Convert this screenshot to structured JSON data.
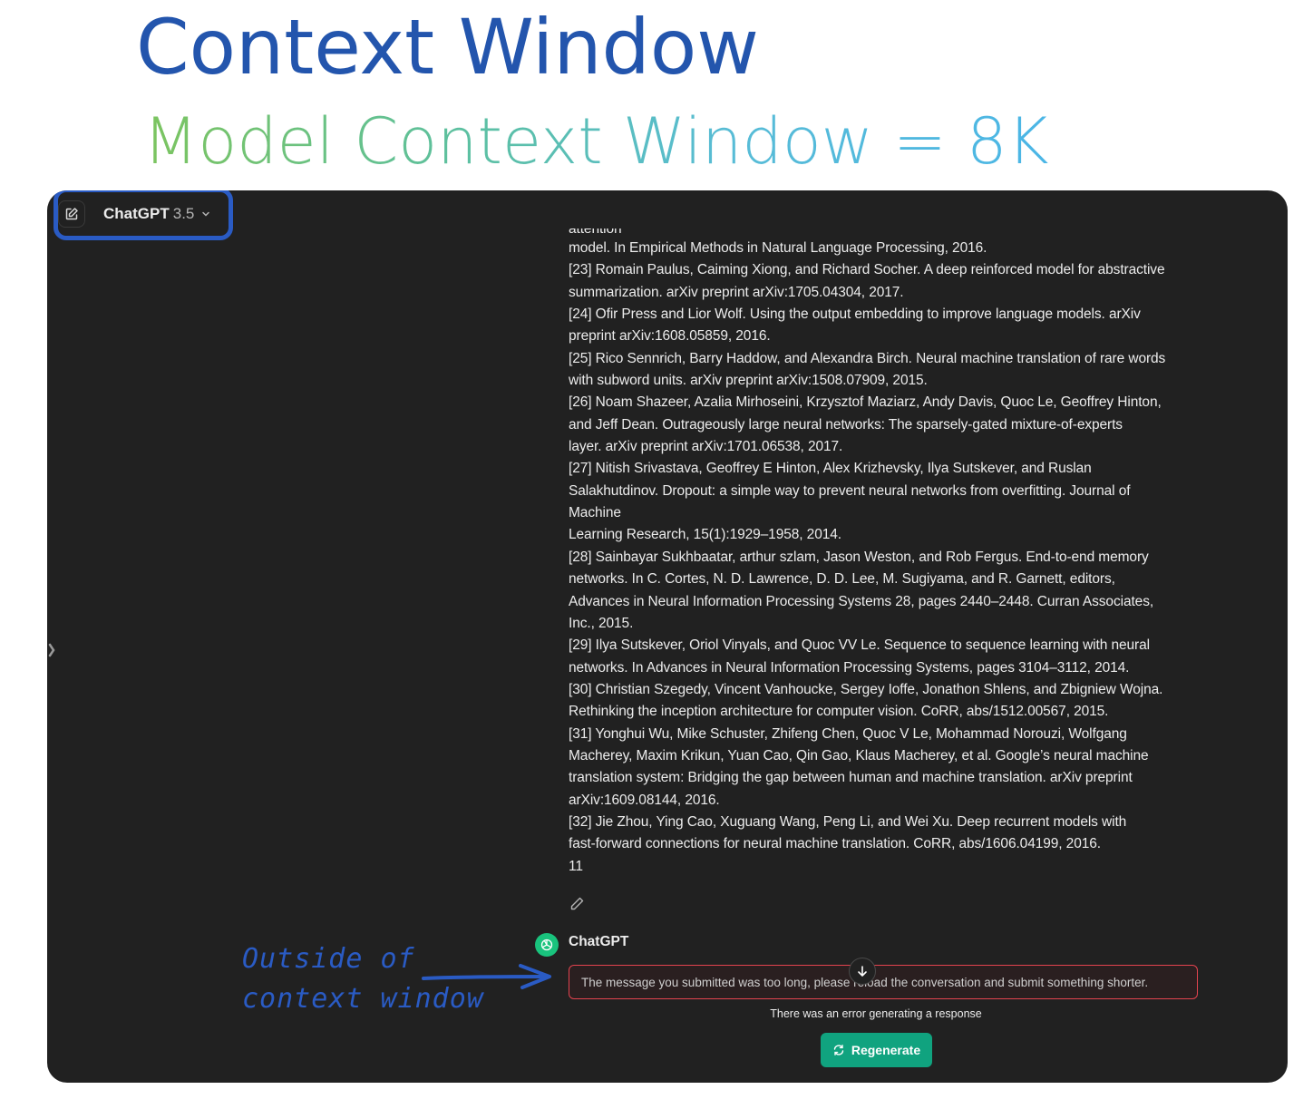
{
  "slide": {
    "title": "Context Window",
    "subtitle": "Model Context Window = 8K"
  },
  "topbar": {
    "model_name": "ChatGPT",
    "model_version": "3.5",
    "new_chat_icon": "edit-icon",
    "dropdown_icon": "chevron-down-icon"
  },
  "message": {
    "lines": [
      "attention",
      "model. In Empirical Methods in Natural Language Processing, 2016.",
      "[23] Romain Paulus, Caiming Xiong, and Richard Socher. A deep reinforced model for abstractive",
      "summarization. arXiv preprint arXiv:1705.04304, 2017.",
      "[24] Ofir Press and Lior Wolf. Using the output embedding to improve language models. arXiv",
      "preprint arXiv:1608.05859, 2016.",
      "[25] Rico Sennrich, Barry Haddow, and Alexandra Birch. Neural machine translation of rare words",
      "with subword units. arXiv preprint arXiv:1508.07909, 2015.",
      "[26] Noam Shazeer, Azalia Mirhoseini, Krzysztof Maziarz, Andy Davis, Quoc Le, Geoffrey Hinton,",
      "and Jeff Dean. Outrageously large neural networks: The sparsely-gated mixture-of-experts",
      "layer. arXiv preprint arXiv:1701.06538, 2017.",
      "[27] Nitish Srivastava, Geoffrey E Hinton, Alex Krizhevsky, Ilya Sutskever, and Ruslan",
      "Salakhutdinov. Dropout: a simple way to prevent neural networks from overfitting. Journal of",
      "Machine",
      "Learning Research, 15(1):1929–1958, 2014.",
      "[28] Sainbayar Sukhbaatar, arthur szlam, Jason Weston, and Rob Fergus. End-to-end memory",
      "networks. In C. Cortes, N. D. Lawrence, D. D. Lee, M. Sugiyama, and R. Garnett, editors,",
      "Advances in Neural Information Processing Systems 28, pages 2440–2448. Curran Associates,",
      "Inc., 2015.",
      "[29] Ilya Sutskever, Oriol Vinyals, and Quoc VV Le. Sequence to sequence learning with neural",
      "networks. In Advances in Neural Information Processing Systems, pages 3104–3112, 2014.",
      "[30] Christian Szegedy, Vincent Vanhoucke, Sergey Ioffe, Jonathon Shlens, and Zbigniew Wojna.",
      "Rethinking the inception architecture for computer vision. CoRR, abs/1512.00567, 2015.",
      "[31] Yonghui Wu, Mike Schuster, Zhifeng Chen, Quoc V Le, Mohammad Norouzi, Wolfgang",
      "Macherey, Maxim Krikun, Yuan Cao, Qin Gao, Klaus Macherey, et al. Google’s neural machine",
      "translation system: Bridging the gap between human and machine translation. arXiv preprint",
      "arXiv:1609.08144, 2016.",
      "[32] Jie Zhou, Ying Cao, Xuguang Wang, Peng Li, and Wei Xu. Deep recurrent models with",
      "fast-forward connections for neural machine translation. CoRR, abs/1606.04199, 2016.",
      "11"
    ]
  },
  "assistant": {
    "name": "ChatGPT",
    "avatar_icon": "openai-logo-icon",
    "error_message": "The message you submitted was too long, please reload the conversation and submit something shorter.",
    "error_caption": "There was an error generating a response",
    "regenerate_label": "Regenerate"
  },
  "annotation": {
    "line1": "Outside of",
    "line2": "context window"
  },
  "colors": {
    "title": "#2355ad",
    "window_bg": "#212121",
    "regenerate": "#10a37f",
    "error_border": "#e2434f",
    "annotation": "#2a5bc4"
  }
}
